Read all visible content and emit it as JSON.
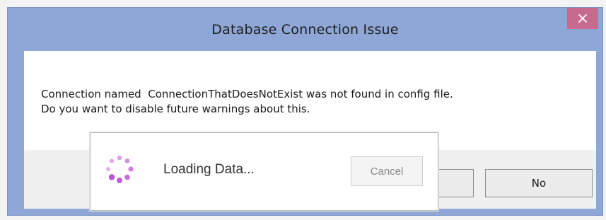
{
  "dialog": {
    "title": "Database Connection Issue",
    "close_icon": "close-icon",
    "message_line_1": "Connection named  ConnectionThatDoesNotExist was not found in config file.",
    "message_line_2": "Do you want to disable future warnings about this.",
    "yes_label": "",
    "no_label": "No",
    "colors": {
      "titlebar": "#8fa7d6",
      "close_button": "#c76a8e"
    }
  },
  "loading_popup": {
    "text": "Loading Data...",
    "cancel_label": "Cancel",
    "spinner_icon": "loading-spinner-icon",
    "spinner_color": "#c04fd8"
  }
}
